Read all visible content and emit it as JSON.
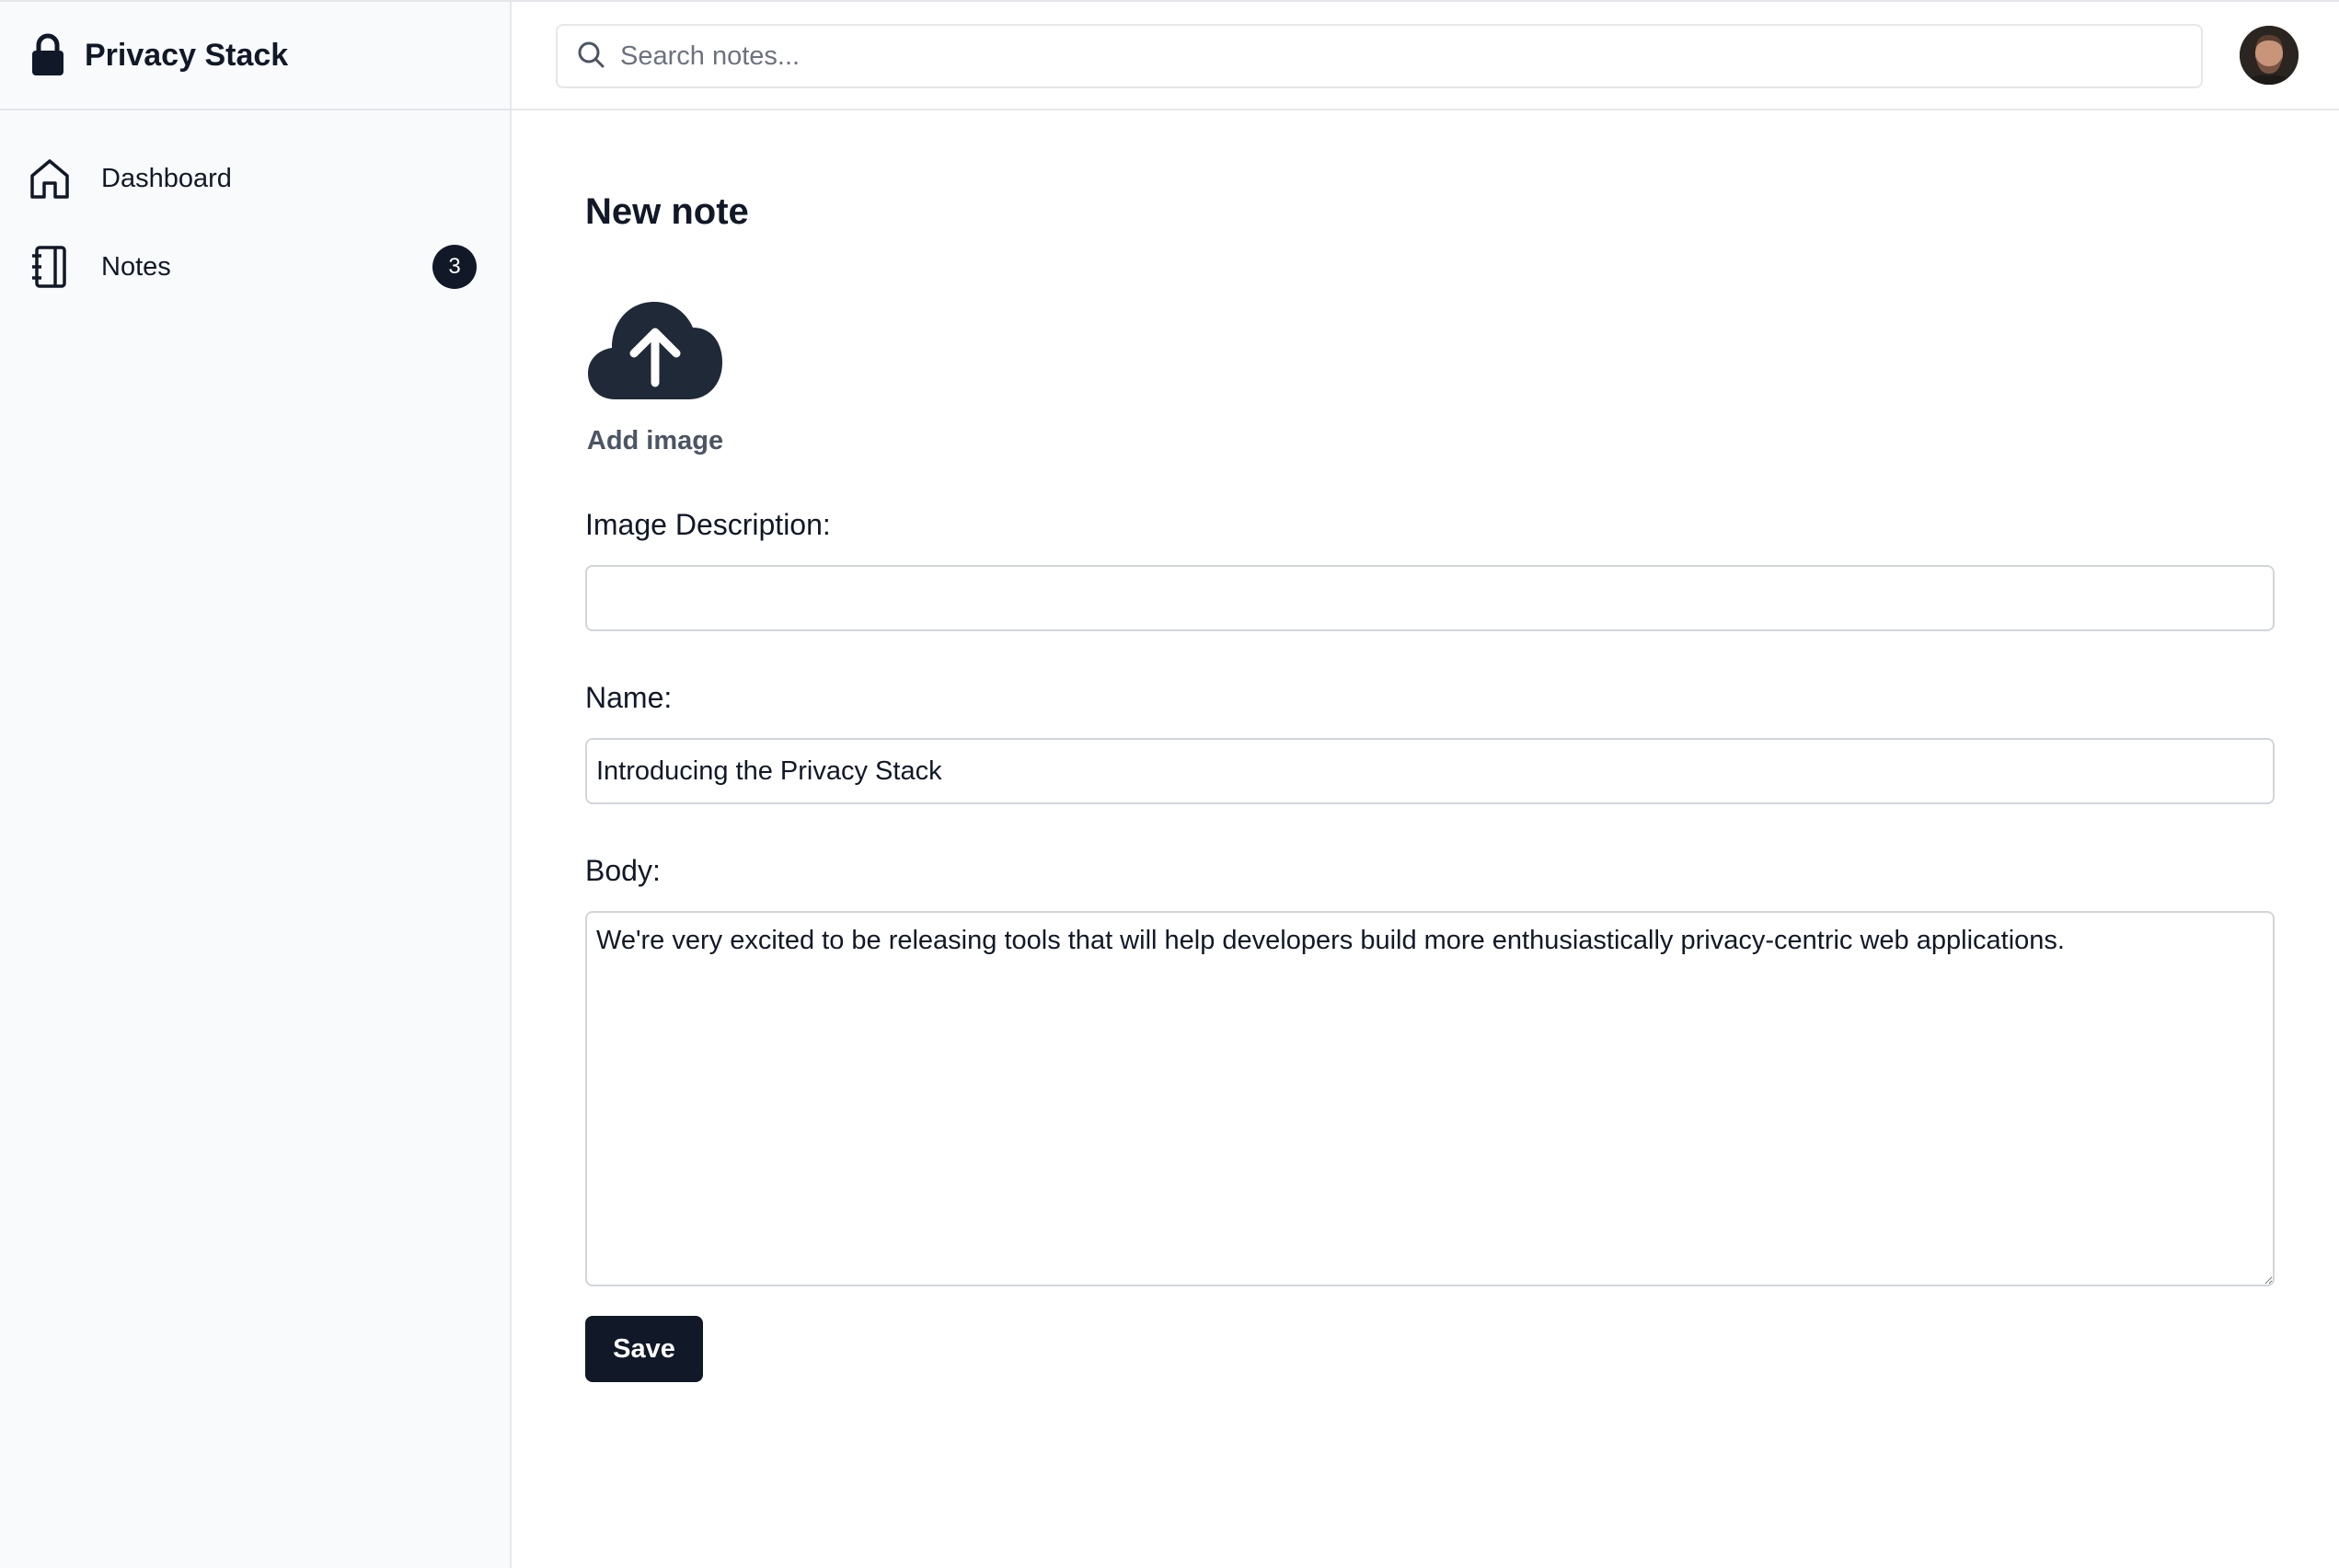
{
  "brand": {
    "name": "Privacy Stack",
    "icon": "lock-icon"
  },
  "sidebar": {
    "items": [
      {
        "label": "Dashboard",
        "icon": "home-icon"
      },
      {
        "label": "Notes",
        "icon": "notebook-icon",
        "badge": "3"
      }
    ]
  },
  "search": {
    "placeholder": "Search notes...",
    "value": ""
  },
  "user": {
    "avatar": "user-avatar"
  },
  "form": {
    "title": "New note",
    "upload_label": "Add image",
    "image_description": {
      "label": "Image Description:",
      "value": ""
    },
    "name": {
      "label": "Name:",
      "value": "Introducing the Privacy Stack"
    },
    "body": {
      "label": "Body:",
      "value": "We're very excited to be releasing tools that will help developers build more enthusiastically privacy-centric web applications."
    },
    "save_label": "Save"
  },
  "colors": {
    "primary": "#111827",
    "border": "#e5e7eb",
    "sidebar_bg": "#f8fafc"
  }
}
